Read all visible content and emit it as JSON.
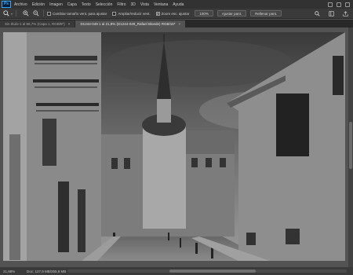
{
  "menubar": {
    "logo": "Ps",
    "items": [
      "Archivo",
      "Edición",
      "Imagen",
      "Capa",
      "Texto",
      "Selección",
      "Filtro",
      "3D",
      "Vista",
      "Ventana",
      "Ayuda"
    ]
  },
  "options": {
    "tool_icon": "zoom-tool-icon",
    "checkboxes": [
      {
        "label": "Cambiar tamaño vent. para ajustar",
        "checked": false
      },
      {
        "label": "Ampliar/reducir vent.",
        "checked": false
      },
      {
        "label": "Zoom esc. ajustar",
        "checked": true
      }
    ],
    "zoom_value": "100%",
    "fit_button": "Ajustar pant.",
    "fill_button": "Rellenar pant."
  },
  "tabs": [
    {
      "label": "Sin título-1 al 66,7% (Capa 1, RGB/8*)",
      "active": false
    },
    {
      "label": "D1244-049 1 al 21,8% (D1244-049_Rafael Bloede) RGB/16*",
      "active": true
    }
  ],
  "status": {
    "zoom": "21,88%",
    "doc_info": "Doc: 127,9 MB/255,9 MB"
  },
  "colors": {
    "menubar_bg": "#323232",
    "workspace_bg": "#535353",
    "ps_accent": "#31a8ff"
  }
}
